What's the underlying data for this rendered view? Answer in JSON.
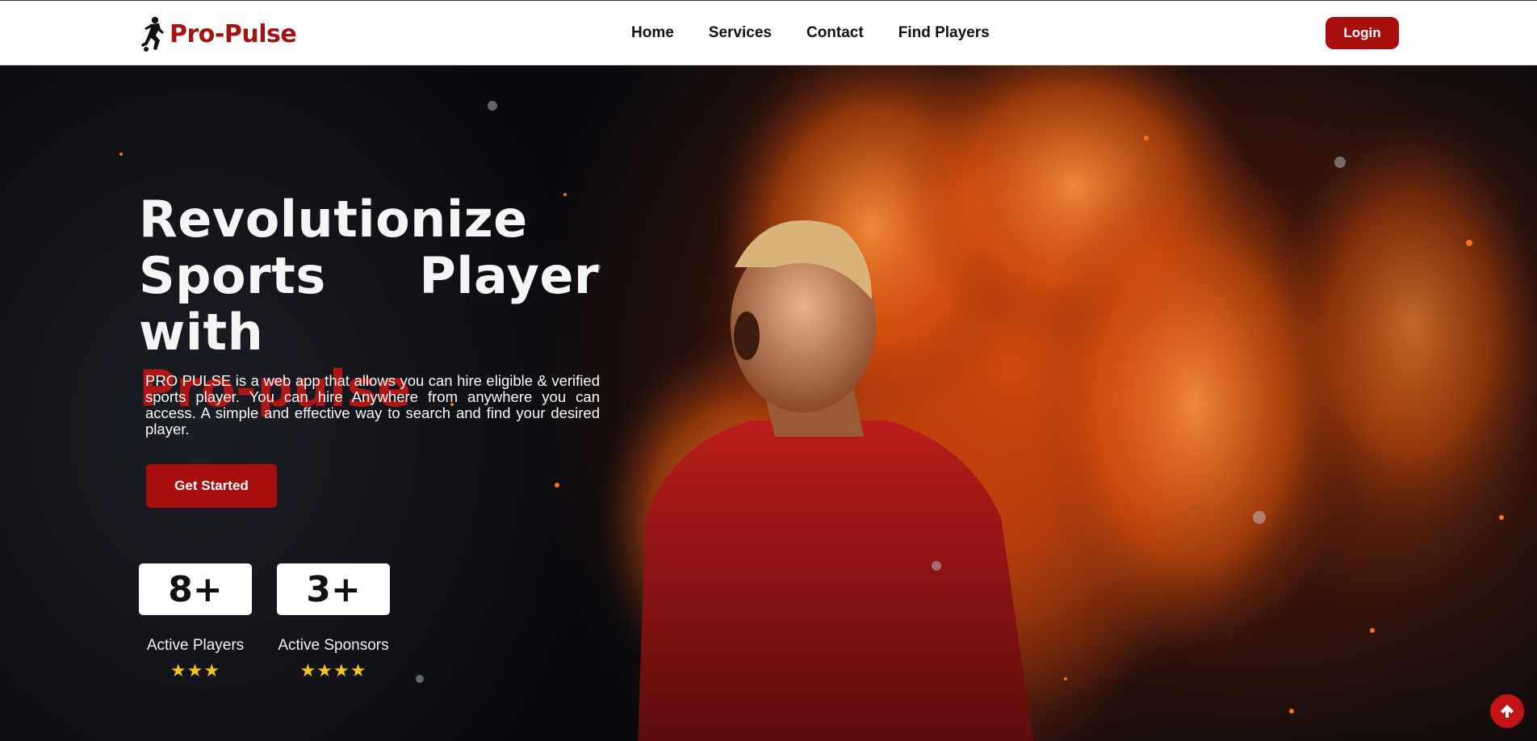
{
  "nav": {
    "brand": "Pro-Pulse",
    "links": [
      "Home",
      "Services",
      "Contact",
      "Find Players"
    ],
    "login_label": "Login"
  },
  "hero": {
    "title_line1": "Revolutionize",
    "title_line2": "Sports Player with",
    "title_accent": "Pro-pulse",
    "description": "PRO PULSE is a web app that allows you can hire eligible & verified sports player. You can hire Anywhere from anywhere you can access. A simple and effective way to search and find your desired player.",
    "cta_label": "Get Started"
  },
  "stats": [
    {
      "value": "8+",
      "label": "Active Players",
      "stars": "★★★",
      "rating": 3
    },
    {
      "value": "3+",
      "label": "Active Sponsors",
      "stars": "★★★★",
      "rating": 4
    }
  ],
  "colors": {
    "brand_red": "#a70f0f",
    "accent_text": "#b01616",
    "star": "#f5c518"
  },
  "icons": {
    "logo": "soccer-player-icon",
    "scroll_top": "arrow-up-icon"
  }
}
